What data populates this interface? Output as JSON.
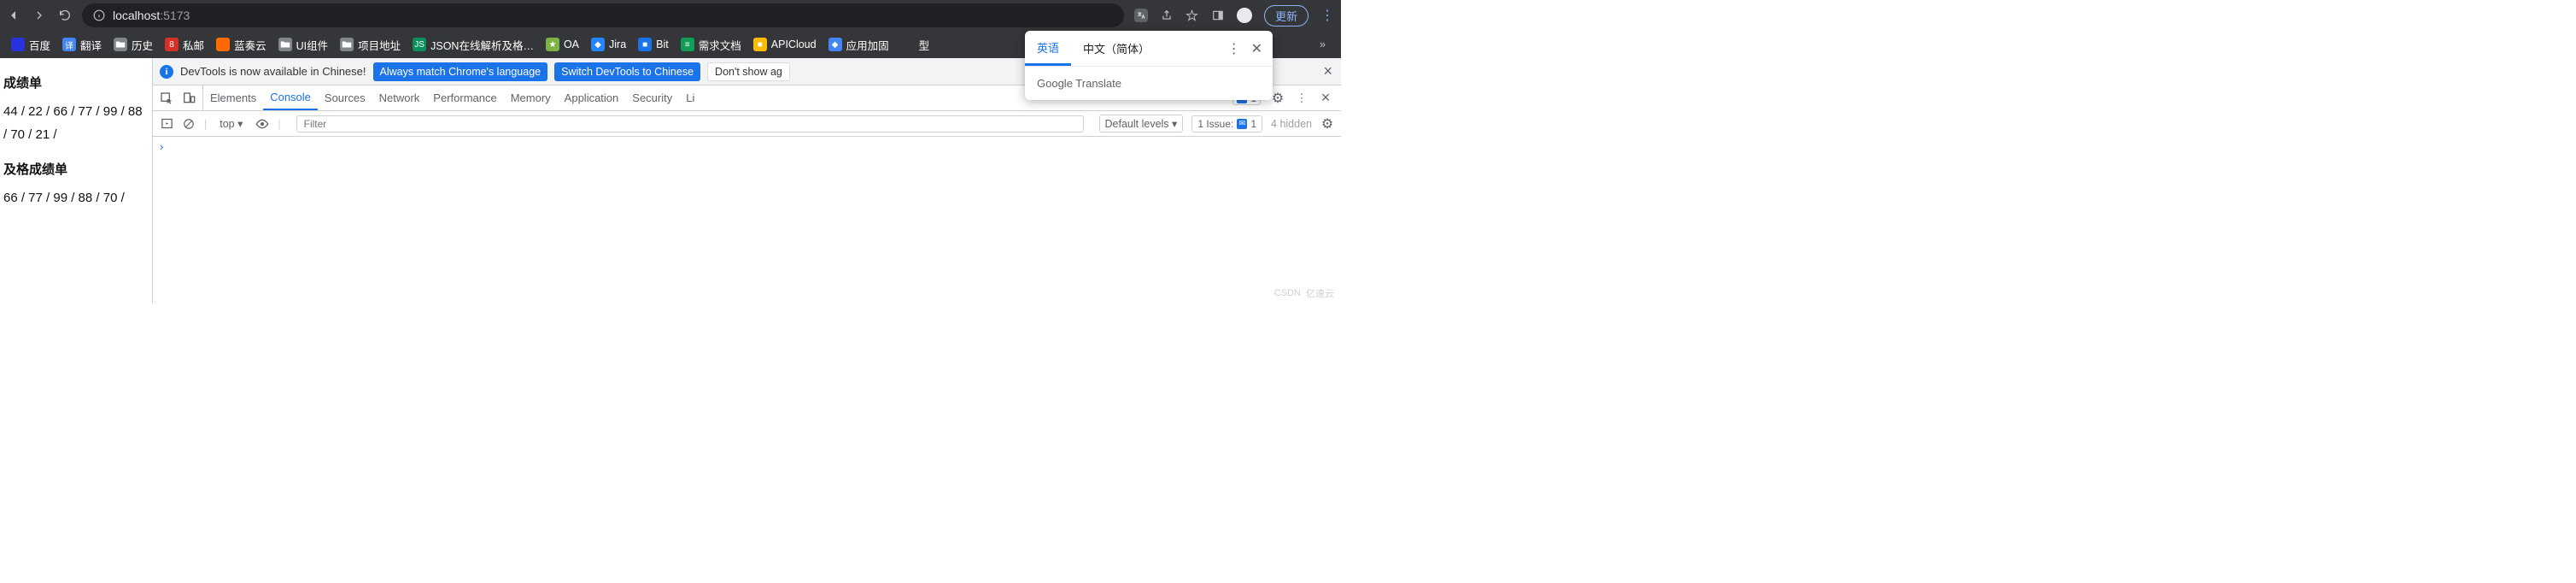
{
  "toolbar": {
    "url_scheme": "localhost",
    "url_port": ":5173",
    "update_label": "更新"
  },
  "bookmarks": [
    {
      "label": "百度",
      "color": "#2932e1"
    },
    {
      "label": "翻译",
      "color": "#4285f4",
      "badge": "译"
    },
    {
      "label": "历史",
      "folder": true
    },
    {
      "label": "私邮",
      "color": "#d93025",
      "badge": "8"
    },
    {
      "label": "蓝奏云",
      "color": "#ff6a00"
    },
    {
      "label": "UI组件",
      "folder": true
    },
    {
      "label": "项目地址",
      "folder": true
    },
    {
      "label": "JSON在线解析及格…",
      "color": "#0a8f5b",
      "badge": "JS"
    },
    {
      "label": "OA",
      "color": "#7cb342",
      "badge": "★"
    },
    {
      "label": "Jira",
      "color": "#2684ff",
      "badge": "◆"
    },
    {
      "label": "Bit",
      "color": "#1a73e8",
      "badge": "■"
    },
    {
      "label": "需求文档",
      "color": "#0f9d58",
      "badge": "≡"
    },
    {
      "label": "APICloud",
      "color": "#fbbc04",
      "badge": "■"
    },
    {
      "label": "应用加固",
      "color": "#4285f4",
      "badge": "◆"
    },
    {
      "label": "型",
      "cut": true
    }
  ],
  "page": {
    "h1": "成绩单",
    "list1": "44 / 22 / 66 / 77 / 99 / 88 / 70 / 21 /",
    "h2": "及格成绩单",
    "list2": "66 / 77 / 99 / 88 / 70 /"
  },
  "infobar": {
    "msg": "DevTools is now available in Chinese!",
    "b1": "Always match Chrome's language",
    "b2": "Switch DevTools to Chinese",
    "b3": "Don't show ag"
  },
  "tabs": {
    "items": [
      "Elements",
      "Console",
      "Sources",
      "Network",
      "Performance",
      "Memory",
      "Application",
      "Security",
      "Li"
    ],
    "active": 1,
    "badge_count": "1"
  },
  "console": {
    "context": "top ▾",
    "filter_placeholder": "Filter",
    "levels": "Default levels ▾",
    "issues_label": "1 Issue:",
    "issues_count": "1",
    "hidden": "4 hidden",
    "prompt": "›"
  },
  "translate": {
    "tab_a": "英语",
    "tab_b": "中文（简体）",
    "brand_a": "Google",
    "brand_b": " Translate"
  },
  "watermark": {
    "a": "CSDN",
    "b": "亿速云"
  }
}
